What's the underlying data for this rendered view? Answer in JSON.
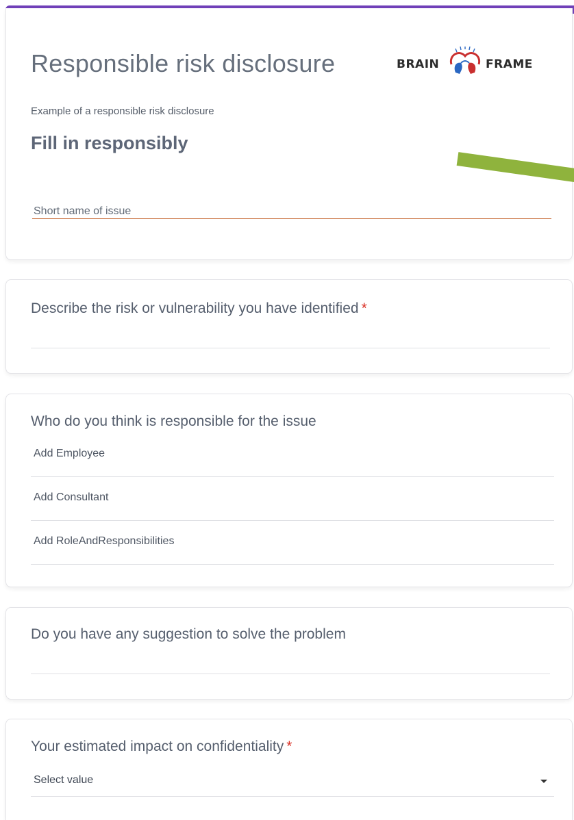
{
  "header": {
    "title": "Responsible risk disclosure",
    "description": "Example of a responsible risk disclosure",
    "subheading": "Fill in responsibly",
    "logo": {
      "left_word": "BRAIN",
      "right_word": "FRAME",
      "icon": "brain-heads-icon"
    }
  },
  "short_name": {
    "placeholder": "Short name of issue"
  },
  "questions": {
    "risk": {
      "label": "Describe the risk or vulnerability you have identified",
      "required": "*"
    },
    "responsible": {
      "label": "Who do you think is responsible for the issue",
      "options": [
        "Add Employee",
        "Add Consultant",
        "Add RoleAndResponsibilities"
      ]
    },
    "suggestion": {
      "label": "Do you have any suggestion to solve the problem"
    },
    "confidentiality": {
      "label": "Your estimated impact on confidentiality",
      "required": "*",
      "select_value": "Select value"
    }
  },
  "colors": {
    "accent": "#7040b8",
    "required": "#d93025",
    "arrow": "#8fb33d"
  }
}
